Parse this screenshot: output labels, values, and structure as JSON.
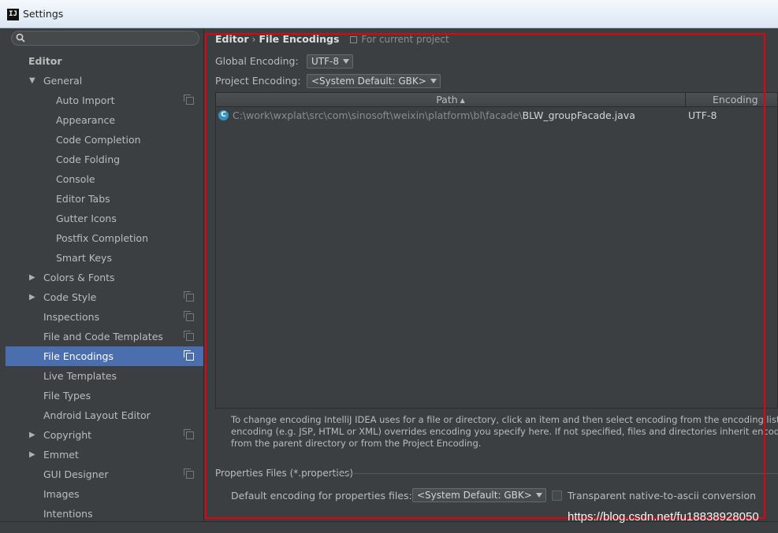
{
  "window": {
    "title": "Settings",
    "app_icon": "intellij-icon"
  },
  "sidebar": {
    "search": {
      "value": "",
      "placeholder": ""
    },
    "items": [
      {
        "label": "Editor",
        "type": "section"
      },
      {
        "label": "General",
        "arrow": "▼",
        "level": 1
      },
      {
        "label": "Auto Import",
        "level": 2,
        "copy_icon": true
      },
      {
        "label": "Appearance",
        "level": 2
      },
      {
        "label": "Code Completion",
        "level": 2
      },
      {
        "label": "Code Folding",
        "level": 2
      },
      {
        "label": "Console",
        "level": 2
      },
      {
        "label": "Editor Tabs",
        "level": 2
      },
      {
        "label": "Gutter Icons",
        "level": 2
      },
      {
        "label": "Postfix Completion",
        "level": 2
      },
      {
        "label": "Smart Keys",
        "level": 2
      },
      {
        "label": "Colors & Fonts",
        "arrow": "▶",
        "level": 1
      },
      {
        "label": "Code Style",
        "arrow": "▶",
        "level": 1,
        "copy_icon": true
      },
      {
        "label": "Inspections",
        "level": 1,
        "copy_icon": true
      },
      {
        "label": "File and Code Templates",
        "level": 1,
        "copy_icon": true
      },
      {
        "label": "File Encodings",
        "level": 1,
        "copy_icon": true,
        "selected": true
      },
      {
        "label": "Live Templates",
        "level": 1
      },
      {
        "label": "File Types",
        "level": 1
      },
      {
        "label": "Android Layout Editor",
        "level": 1
      },
      {
        "label": "Copyright",
        "arrow": "▶",
        "level": 1,
        "copy_icon": true
      },
      {
        "label": "Emmet",
        "arrow": "▶",
        "level": 1
      },
      {
        "label": "GUI Designer",
        "level": 1,
        "copy_icon": true
      },
      {
        "label": "Images",
        "level": 1
      },
      {
        "label": "Intentions",
        "level": 1
      }
    ]
  },
  "breadcrumb": {
    "parent": "Editor",
    "separator": "›",
    "current": "File Encodings",
    "scope_note": "For current project"
  },
  "global_encoding": {
    "label": "Global Encoding:",
    "value": "UTF-8"
  },
  "project_encoding": {
    "label": "Project Encoding:",
    "value": "<System Default: GBK>"
  },
  "table": {
    "headers": {
      "path": "Path",
      "sort_arrow": "▲",
      "encoding": "Encoding"
    },
    "rows": [
      {
        "icon": "C",
        "dir": "C:\\work\\wxplat\\src\\com\\sinosoft\\weixin\\platform\\bl\\facade\\",
        "file": "BLW_groupFacade.java",
        "encoding": "UTF-8"
      }
    ]
  },
  "info_text": [
    "To change encoding IntelliJ IDEA uses for a file or directory, click an item and then select encoding from the encoding list. Built-in file",
    "encoding (e.g. JSP, HTML or XML) overrides encoding you specify here. If not specified, files and directories inherit encoding settings",
    "from the parent directory or from the Project Encoding."
  ],
  "properties": {
    "section_title": "Properties Files (*.properties)",
    "default_label": "Default encoding for properties files:",
    "default_value": "<System Default: GBK>",
    "checkbox_label": "Transparent native-to-ascii conversion",
    "checkbox_checked": false
  },
  "watermark": "https://blog.csdn.net/fu18838928050",
  "colors": {
    "accent_selected": "#4b6eaf",
    "highlight_rect": "#e8000d",
    "background": "#3c3f41"
  }
}
